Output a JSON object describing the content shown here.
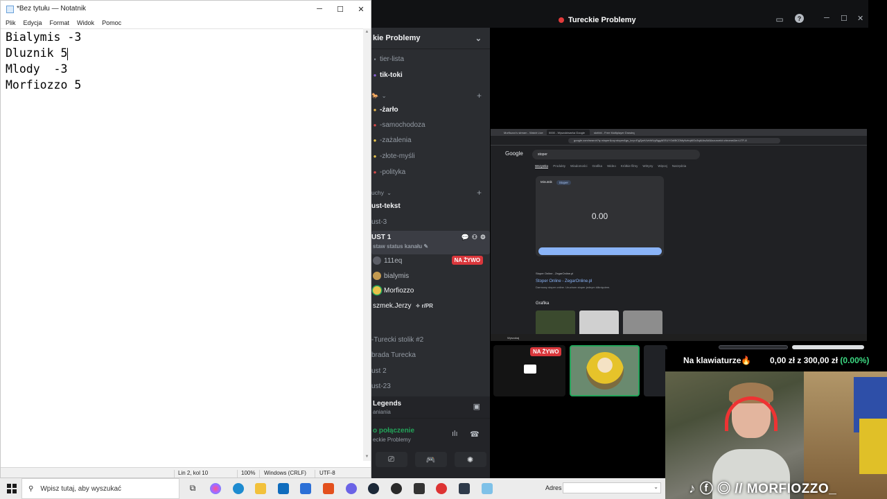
{
  "notepad": {
    "title": "*Bez tytułu — Notatnik",
    "menu": [
      "Plik",
      "Edycja",
      "Format",
      "Widok",
      "Pomoc"
    ],
    "lines": [
      "Bialymis -3",
      "Dluznik 5",
      "Mlody  -3",
      "Morfiozzo 5"
    ],
    "status": {
      "position": "Lin 2, kol 10",
      "zoom": "100%",
      "line_ending": "Windows (CRLF)",
      "encoding": "UTF-8"
    }
  },
  "discord": {
    "window_title": "Tureckie Problemy",
    "server_name": "kie Problemy",
    "channels": [
      {
        "label": "tier-lista",
        "icon": "hash-icon",
        "bright": false
      },
      {
        "label": "tik-toki",
        "icon": "hash-icon",
        "bright": true
      },
      {
        "label": "-żarło",
        "icon": "hash-icon",
        "bright": true
      },
      {
        "label": "-samochodoza",
        "icon": "hash-icon",
        "bright": false
      },
      {
        "label": "-zażalenia",
        "icon": "hash-icon",
        "bright": false
      },
      {
        "label": "-złote-myśli",
        "icon": "hash-icon",
        "bright": false
      },
      {
        "label": "-polityka",
        "icon": "hash-icon",
        "bright": false
      }
    ],
    "category_1": "uchy",
    "channels_2": [
      {
        "label": "ust-tekst",
        "bright": true
      },
      {
        "label": "ust-3",
        "bright": false
      }
    ],
    "voice_channel": {
      "name": "UST 1",
      "status_placeholder": "staw status kanału",
      "users": [
        {
          "name": "111eq",
          "live": true
        },
        {
          "name": "bialymis",
          "live": false
        },
        {
          "name": "Morfiozzo",
          "live": false
        },
        {
          "name": "szmek.Jerzy",
          "live": false,
          "tag": "r/PR"
        }
      ],
      "live_label": "NA ŻYWO"
    },
    "channels_3": [
      "-Turecki stolik #2",
      "brada Turecka",
      "ust 2",
      "ust-23"
    ],
    "activity": {
      "title": "Legends",
      "subtitle": "aniania"
    },
    "voice_status": {
      "title": "o połączenie",
      "subtitle": "eckie Problemy"
    },
    "thumb_live_label": "NA ŻYWO"
  },
  "stream": {
    "tabs": [
      "Morfiozzo's stream - Watch Live",
      "0000 - Wyszukiwarka Google",
      "skribbl - Free Multiplayer Drawing"
    ],
    "url": "google.com/search?q=stoper&oq=stoper&gs_lcrp=EgZjaHJvbWUyBggAEEUYOdIBCDMyNzhqMGo3qAIAsAIA&sourceid=chrome&ie=UTF-8",
    "search_query": "stoper",
    "filters": [
      "Wszystko",
      "Produkty",
      "Wiadomości",
      "Grafika",
      "Wideo",
      "Krótkie filmy",
      "Witryny",
      "Więcej",
      "Narzędzia"
    ],
    "timer_tabs": [
      "Minutnik",
      "Stoper"
    ],
    "timer_value": "0.00",
    "result_site": "Stoper Online - ZegarOnline.pl",
    "result_link": "Stoper Online - ZegarOnline.pl",
    "result_desc": "Darmowy stoper online. Uruchom stoper jednym kliknięciem.",
    "images_label": "Grafika",
    "taskbar_label": "Wyszukaj"
  },
  "webcam": {
    "keyboard_label": "Na klawiaturze🔥",
    "goal_prefix": "0,00 zł z 300,00 zł",
    "goal_percent": "(0.00%)",
    "handle": "// MORFIOZZO_"
  },
  "taskbar": {
    "search_placeholder": "Wpisz tutaj, aby wyszukać",
    "address_label": "Adres"
  }
}
